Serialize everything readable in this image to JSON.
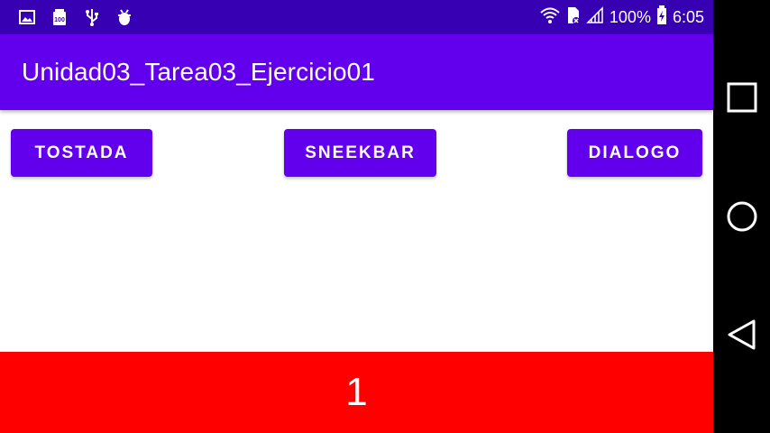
{
  "status_bar": {
    "left_icons": [
      "image-icon",
      "battery-100-icon",
      "usb-icon",
      "bug-icon"
    ],
    "battery_percent": "100%",
    "time": "6:05",
    "background": "#3700b3"
  },
  "app_bar": {
    "title": "Unidad03_Tarea03_Ejercicio01",
    "background": "#6200ee"
  },
  "buttons": {
    "tostada": "TOSTADA",
    "sneekbar": "SNEEKBAR",
    "dialogo": "DIALOGO",
    "color": "#6200ee"
  },
  "counter": {
    "value": "1",
    "background": "#ff0000"
  },
  "nav_bar": {
    "items": [
      "recents-square-icon",
      "home-circle-icon",
      "back-triangle-icon"
    ]
  }
}
